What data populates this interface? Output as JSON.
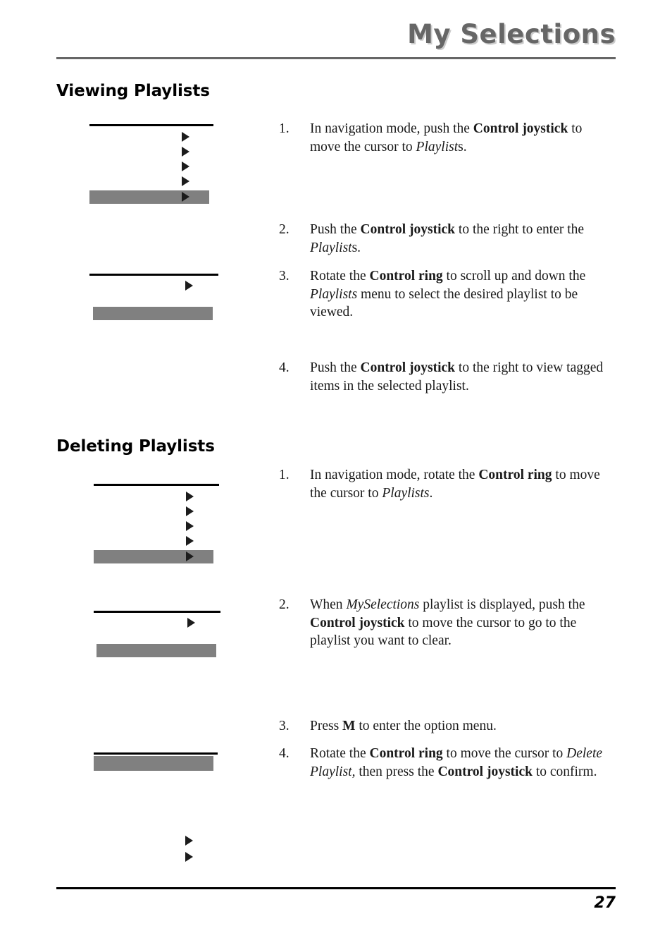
{
  "header": {
    "title": "My Selections"
  },
  "sections": [
    {
      "heading": "Viewing Playlists",
      "steps": [
        {
          "number": "1.",
          "parts": [
            {
              "t": "In navigation mode, push the ",
              "s": "normal"
            },
            {
              "t": "Control joystick",
              "s": "bold"
            },
            {
              "t": " to move the cursor to ",
              "s": "normal"
            },
            {
              "t": "Playlist",
              "s": "italic"
            },
            {
              "t": "s.",
              "s": "normal"
            }
          ]
        },
        {
          "number": "2.",
          "parts": [
            {
              "t": "Push the ",
              "s": "normal"
            },
            {
              "t": "Control joystick",
              "s": "bold"
            },
            {
              "t": " to the right to enter the ",
              "s": "normal"
            },
            {
              "t": "Playlist",
              "s": "italic"
            },
            {
              "t": "s.",
              "s": "normal"
            }
          ]
        },
        {
          "number": "3.",
          "parts": [
            {
              "t": "Rotate the ",
              "s": "normal"
            },
            {
              "t": "Control ring",
              "s": "bold"
            },
            {
              "t": " to scroll up and down the ",
              "s": "normal"
            },
            {
              "t": "Playlists",
              "s": "italic"
            },
            {
              "t": " menu to select the desired playlist to be viewed.",
              "s": "normal"
            }
          ]
        },
        {
          "number": "4.",
          "parts": [
            {
              "t": "Push the ",
              "s": "normal"
            },
            {
              "t": "Control joystick",
              "s": "bold"
            },
            {
              "t": " to the right to view tagged items in the selected playlist.",
              "s": "normal"
            }
          ]
        }
      ]
    },
    {
      "heading": "Deleting Playlists",
      "steps": [
        {
          "number": "1.",
          "parts": [
            {
              "t": "In navigation mode, rotate the ",
              "s": "normal"
            },
            {
              "t": "Control ring",
              "s": "bold"
            },
            {
              "t": " to move the cursor to ",
              "s": "normal"
            },
            {
              "t": "Playlists",
              "s": "italic"
            },
            {
              "t": ".",
              "s": "normal"
            }
          ]
        },
        {
          "number": "2.",
          "parts": [
            {
              "t": "When ",
              "s": "normal"
            },
            {
              "t": "MySelections",
              "s": "italic"
            },
            {
              "t": " playlist is displayed, push the ",
              "s": "normal"
            },
            {
              "t": "Control joystick",
              "s": "bold"
            },
            {
              "t": " to move the cursor to go to the playlist you want to clear.",
              "s": "normal"
            }
          ]
        },
        {
          "number": "3.",
          "parts": [
            {
              "t": "Press ",
              "s": "normal"
            },
            {
              "t": "M",
              "s": "bold"
            },
            {
              "t": " to enter the option menu.",
              "s": "normal"
            }
          ]
        },
        {
          "number": "4.",
          "parts": [
            {
              "t": "Rotate the ",
              "s": "normal"
            },
            {
              "t": "Control ring",
              "s": "bold"
            },
            {
              "t": " to move the cursor to ",
              "s": "normal"
            },
            {
              "t": "Delete Playlist,",
              "s": "italic"
            },
            {
              "t": " then press the ",
              "s": "normal"
            },
            {
              "t": "Control joystick",
              "s": "bold"
            },
            {
              "t": " to confirm.",
              "s": "normal"
            }
          ]
        }
      ]
    }
  ],
  "footer": {
    "page_number": "27"
  },
  "colors": {
    "header_gray": "#666666",
    "highlight_gray": "#808080",
    "rule_black": "#000000"
  }
}
